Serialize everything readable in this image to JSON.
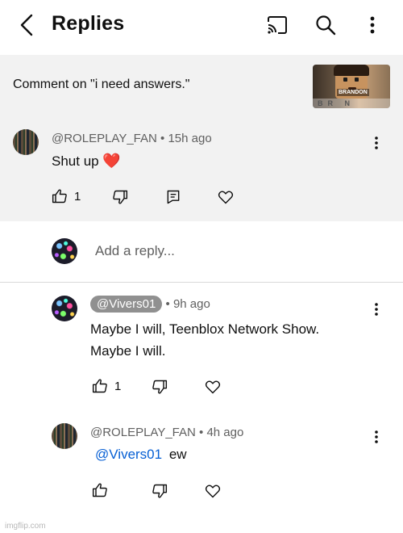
{
  "header": {
    "title": "Replies",
    "icons": [
      "back-arrow-icon",
      "cast-icon",
      "search-icon",
      "more-vert-icon"
    ]
  },
  "context": {
    "text": "Comment on \"i need answers.\"",
    "thumbnail": {
      "name_tag": "BRANDON",
      "footer_text": "BR   N"
    }
  },
  "parent_comment": {
    "author": "@ROLEPLAY_FAN",
    "separator": "•",
    "time": "15h ago",
    "text": "Shut up",
    "emoji": "❤️",
    "likes": "1"
  },
  "reply_box": {
    "placeholder": "Add a reply..."
  },
  "replies": [
    {
      "author": "@Vivers01",
      "separator": "•",
      "time": "9h ago",
      "line1": "Maybe I will, Teenblox Network Show.",
      "line2": "Maybe I will.",
      "likes": "1"
    },
    {
      "author": "@ROLEPLAY_FAN",
      "separator": "•",
      "time": "4h ago",
      "mention": "@Vivers01",
      "text": "ew",
      "likes": ""
    }
  ],
  "watermark": "imgflip.com",
  "colors": {
    "background": "#ffffff",
    "highlight_background": "#f2f2f2",
    "text_primary": "#0f0f0f",
    "text_secondary": "#606060",
    "mention": "#065fd4",
    "chip": "#909090"
  }
}
